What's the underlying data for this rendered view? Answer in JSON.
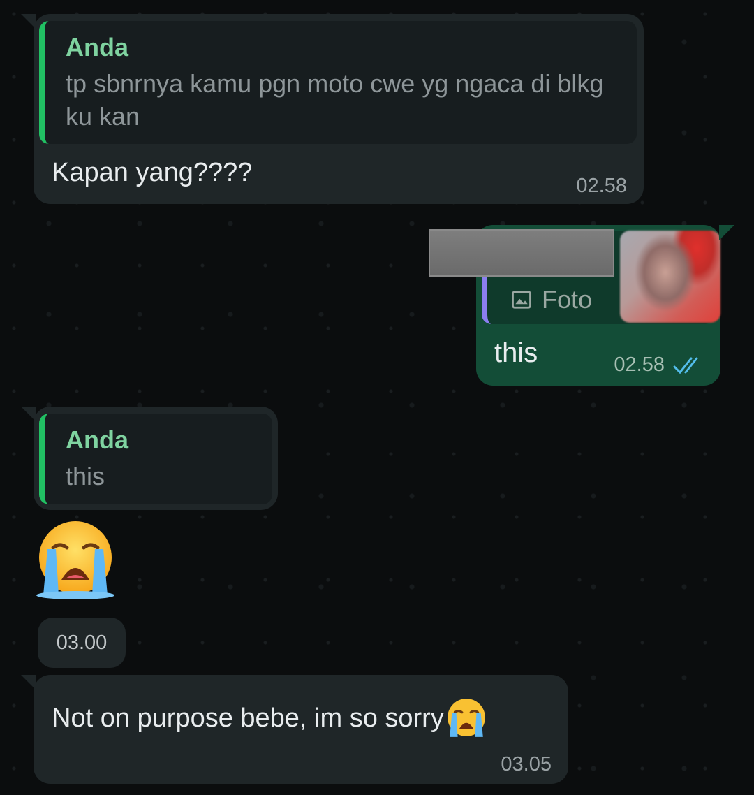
{
  "messages": [
    {
      "quote_author": "Anda",
      "quote_text": "tp sbnrnya kamu pgn moto cwe yg ngaca di blkg ku kan",
      "text": "Kapan yang????",
      "time": "02.58"
    },
    {
      "quote_label": "Foto",
      "text": "this",
      "time": "02.58",
      "status_icon": "double-check-icon"
    },
    {
      "quote_author": "Anda",
      "quote_text": "this",
      "emoji": "loudly-crying-face",
      "time": "03.00"
    },
    {
      "text": "Not on purpose bebe, im so sorry",
      "emoji": "loudly-crying-face",
      "time": "03.05"
    }
  ],
  "colors": {
    "background": "#0b0d0e",
    "incoming_bubble": "#1f2628",
    "outgoing_bubble": "#134d37",
    "quote_bar": "#21c063",
    "read_check": "#53bdeb"
  }
}
